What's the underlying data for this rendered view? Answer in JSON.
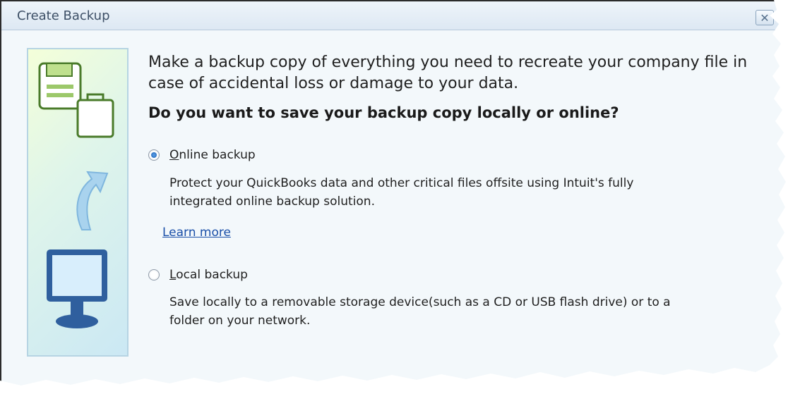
{
  "window": {
    "title": "Create Backup",
    "close_glyph": "✕"
  },
  "content": {
    "intro": "Make a backup copy of everything you need to recreate your company file in case of accidental loss or damage to your data.",
    "question": "Do you want to save your backup copy locally or online?"
  },
  "options": {
    "online": {
      "label_first": "O",
      "label_rest": "nline backup",
      "selected": true,
      "description": "Protect your QuickBooks data and other critical files offsite using Intuit's fully integrated online backup solution.",
      "learn_more": "Learn more"
    },
    "local": {
      "label_first": "L",
      "label_rest": "ocal backup",
      "selected": false,
      "description": "Save locally to a removable storage device(such as a CD or USB flash drive) or to a folder on your network."
    }
  },
  "icons": {
    "left_panel": [
      "floppy-disk-icon",
      "briefcase-icon",
      "curved-arrow-icon",
      "monitor-icon"
    ]
  },
  "colors": {
    "link": "#1a4fa8",
    "radio_selected": "#1d5fb0"
  }
}
